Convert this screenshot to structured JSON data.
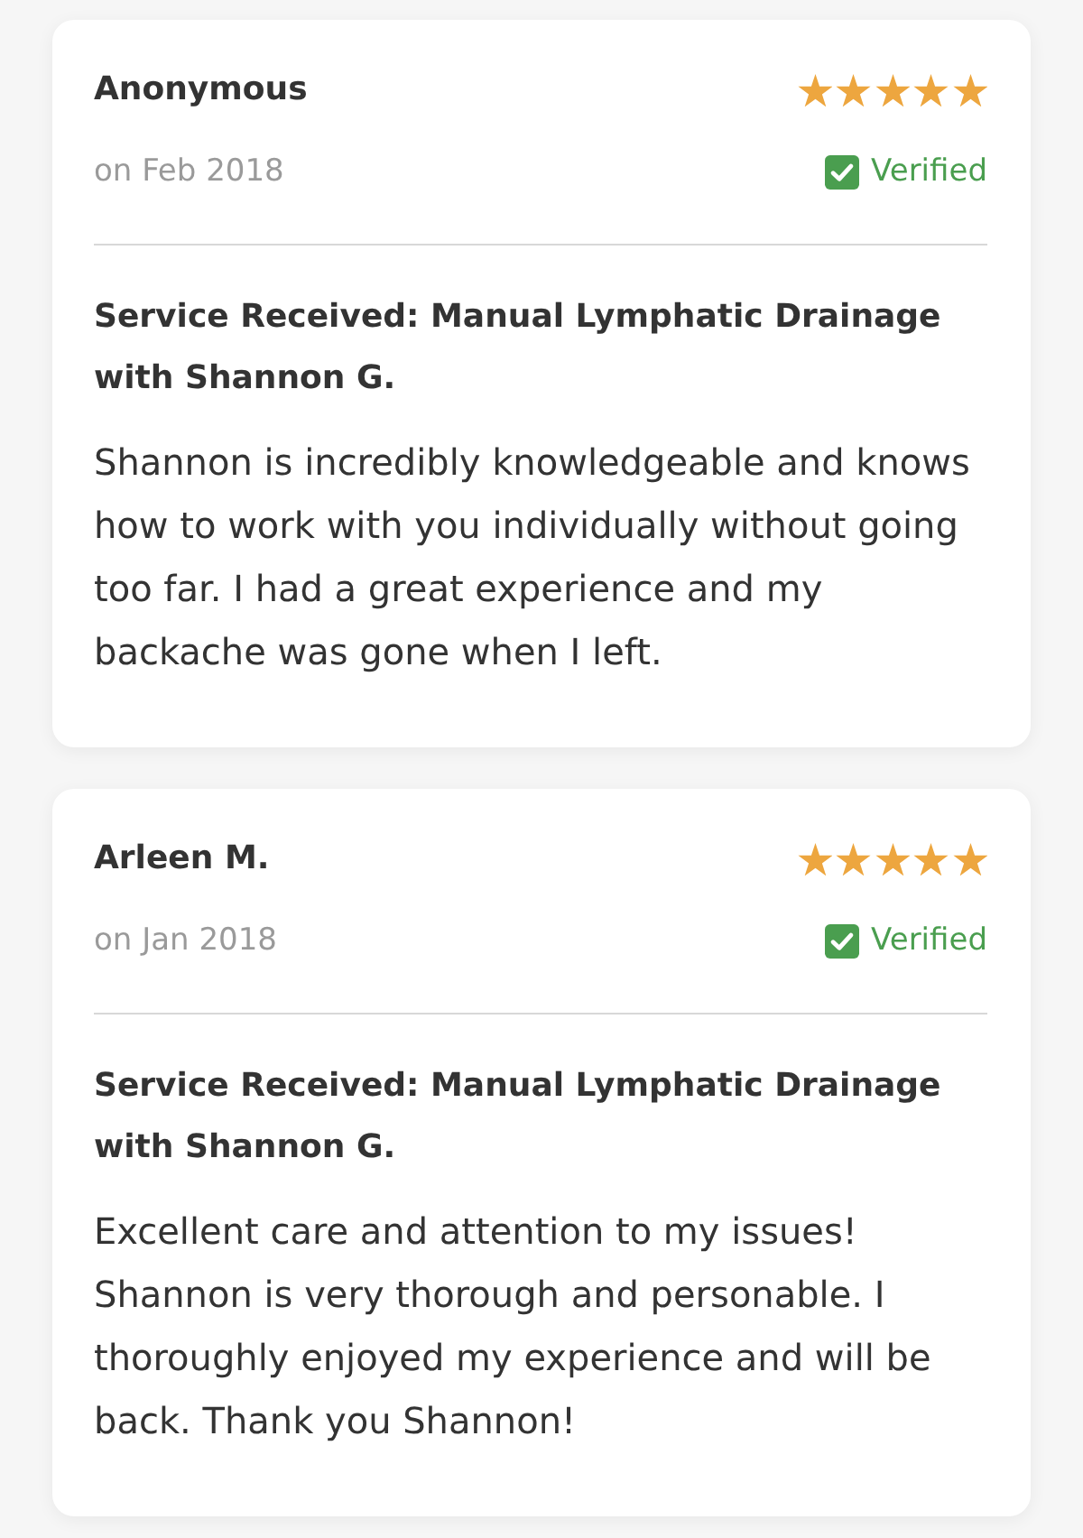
{
  "reviews": [
    {
      "name": "Anonymous",
      "stars": 5,
      "date": "on Feb 2018",
      "verified": true,
      "verified_label": "Verified",
      "service": "Service Received: Manual Lymphatic Drainage with Shannon G.",
      "body": "Shannon is incredibly knowledgeable and knows how to work with you individually without going too far. I had a great experience and my backache was gone when I left."
    },
    {
      "name": "Arleen M.",
      "stars": 5,
      "date": "on Jan 2018",
      "verified": true,
      "verified_label": "Verified",
      "service": "Service Received: Manual Lymphatic Drainage with Shannon G.",
      "body": "Excellent care and attention to my issues! Shannon is very thorough and personable. I thoroughly enjoyed my experience and will be back. Thank you Shannon!"
    }
  ]
}
